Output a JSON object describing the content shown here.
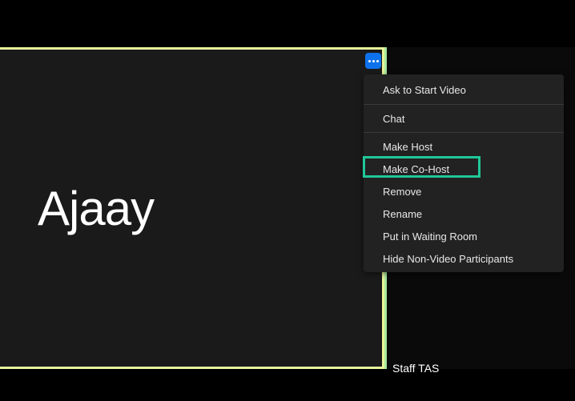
{
  "participant": {
    "mainName": "Ajaay",
    "secondaryName": "Staff TAS"
  },
  "contextMenu": {
    "group1": {
      "askToStartVideo": "Ask to Start Video",
      "chat": "Chat"
    },
    "group2": {
      "makeHost": "Make Host",
      "makeCoHost": "Make Co-Host",
      "remove": "Remove",
      "rename": "Rename",
      "putInWaitingRoom": "Put in Waiting Room",
      "hideNonVideo": "Hide Non-Video Participants"
    }
  }
}
